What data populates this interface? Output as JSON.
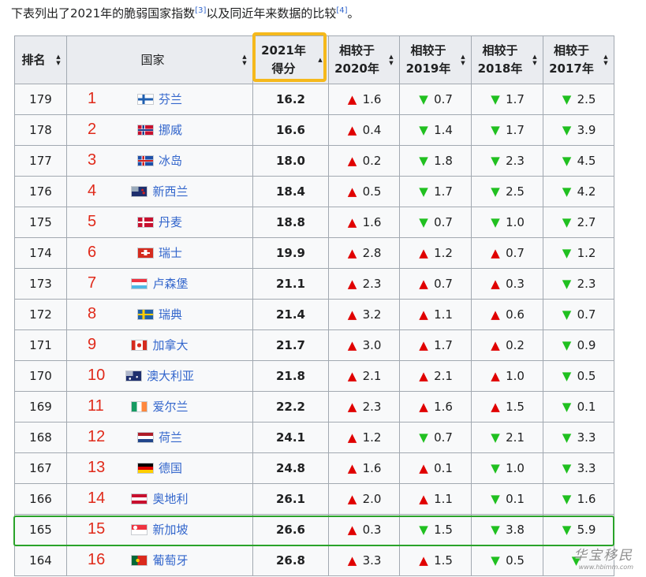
{
  "intro": {
    "text": "下表列出了2021年的脆弱国家指数",
    "ref1": "[3]",
    "mid": "以及同近年来数据的比较",
    "ref2": "[4]",
    "end": "。"
  },
  "headers": {
    "rank": "排名",
    "country": "国家",
    "score": [
      "2021年",
      "得分"
    ],
    "cmp2020": [
      "相较于",
      "2020年"
    ],
    "cmp2019": [
      "相较于",
      "2019年"
    ],
    "cmp2018": [
      "相较于",
      "2018年"
    ],
    "cmp2017": [
      "相较于",
      "2017年"
    ]
  },
  "colors": {
    "up": "#e00000",
    "down": "#20c020",
    "order_number": "#e02a1a",
    "highlight_column": "#f5b91c",
    "highlight_row": "#2aa32a"
  },
  "rows": [
    {
      "rank": "179",
      "order": "1",
      "country": "芬兰",
      "flag": "finland-flag",
      "score": "16.2",
      "c2020": {
        "dir": "up",
        "v": "1.6"
      },
      "c2019": {
        "dir": "down",
        "v": "0.7"
      },
      "c2018": {
        "dir": "down",
        "v": "1.7"
      },
      "c2017": {
        "dir": "down",
        "v": "2.5"
      }
    },
    {
      "rank": "178",
      "order": "2",
      "country": "挪威",
      "flag": "norway-flag",
      "score": "16.6",
      "c2020": {
        "dir": "up",
        "v": "0.4"
      },
      "c2019": {
        "dir": "down",
        "v": "1.4"
      },
      "c2018": {
        "dir": "down",
        "v": "1.7"
      },
      "c2017": {
        "dir": "down",
        "v": "3.9"
      }
    },
    {
      "rank": "177",
      "order": "3",
      "country": "冰岛",
      "flag": "iceland-flag",
      "score": "18.0",
      "c2020": {
        "dir": "up",
        "v": "0.2"
      },
      "c2019": {
        "dir": "down",
        "v": "1.8"
      },
      "c2018": {
        "dir": "down",
        "v": "2.3"
      },
      "c2017": {
        "dir": "down",
        "v": "4.5"
      }
    },
    {
      "rank": "176",
      "order": "4",
      "country": "新西兰",
      "flag": "new-zealand-flag",
      "score": "18.4",
      "c2020": {
        "dir": "up",
        "v": "0.5"
      },
      "c2019": {
        "dir": "down",
        "v": "1.7"
      },
      "c2018": {
        "dir": "down",
        "v": "2.5"
      },
      "c2017": {
        "dir": "down",
        "v": "4.2"
      }
    },
    {
      "rank": "175",
      "order": "5",
      "country": "丹麦",
      "flag": "denmark-flag",
      "score": "18.8",
      "c2020": {
        "dir": "up",
        "v": "1.6"
      },
      "c2019": {
        "dir": "down",
        "v": "0.7"
      },
      "c2018": {
        "dir": "down",
        "v": "1.0"
      },
      "c2017": {
        "dir": "down",
        "v": "2.7"
      }
    },
    {
      "rank": "174",
      "order": "6",
      "country": "瑞士",
      "flag": "switzerland-flag",
      "score": "19.9",
      "c2020": {
        "dir": "up",
        "v": "2.8"
      },
      "c2019": {
        "dir": "up",
        "v": "1.2"
      },
      "c2018": {
        "dir": "up",
        "v": "0.7"
      },
      "c2017": {
        "dir": "down",
        "v": "1.2"
      }
    },
    {
      "rank": "173",
      "order": "7",
      "country": "卢森堡",
      "flag": "luxembourg-flag",
      "score": "21.1",
      "c2020": {
        "dir": "up",
        "v": "2.3"
      },
      "c2019": {
        "dir": "up",
        "v": "0.7"
      },
      "c2018": {
        "dir": "up",
        "v": "0.3"
      },
      "c2017": {
        "dir": "down",
        "v": "2.3"
      }
    },
    {
      "rank": "172",
      "order": "8",
      "country": "瑞典",
      "flag": "sweden-flag",
      "score": "21.4",
      "c2020": {
        "dir": "up",
        "v": "3.2"
      },
      "c2019": {
        "dir": "up",
        "v": "1.1"
      },
      "c2018": {
        "dir": "up",
        "v": "0.6"
      },
      "c2017": {
        "dir": "down",
        "v": "0.7"
      }
    },
    {
      "rank": "171",
      "order": "9",
      "country": "加拿大",
      "flag": "canada-flag",
      "score": "21.7",
      "c2020": {
        "dir": "up",
        "v": "3.0"
      },
      "c2019": {
        "dir": "up",
        "v": "1.7"
      },
      "c2018": {
        "dir": "up",
        "v": "0.2"
      },
      "c2017": {
        "dir": "down",
        "v": "0.9"
      }
    },
    {
      "rank": "170",
      "order": "10",
      "country": "澳大利亚",
      "flag": "australia-flag",
      "score": "21.8",
      "c2020": {
        "dir": "up",
        "v": "2.1"
      },
      "c2019": {
        "dir": "up",
        "v": "2.1"
      },
      "c2018": {
        "dir": "up",
        "v": "1.0"
      },
      "c2017": {
        "dir": "down",
        "v": "0.5"
      }
    },
    {
      "rank": "169",
      "order": "11",
      "country": "爱尔兰",
      "flag": "ireland-flag",
      "score": "22.2",
      "c2020": {
        "dir": "up",
        "v": "2.3"
      },
      "c2019": {
        "dir": "up",
        "v": "1.6"
      },
      "c2018": {
        "dir": "up",
        "v": "1.5"
      },
      "c2017": {
        "dir": "down",
        "v": "0.1"
      }
    },
    {
      "rank": "168",
      "order": "12",
      "country": "荷兰",
      "flag": "netherlands-flag",
      "score": "24.1",
      "c2020": {
        "dir": "up",
        "v": "1.2"
      },
      "c2019": {
        "dir": "down",
        "v": "0.7"
      },
      "c2018": {
        "dir": "down",
        "v": "2.1"
      },
      "c2017": {
        "dir": "down",
        "v": "3.3"
      }
    },
    {
      "rank": "167",
      "order": "13",
      "country": "德国",
      "flag": "germany-flag",
      "score": "24.8",
      "c2020": {
        "dir": "up",
        "v": "1.6"
      },
      "c2019": {
        "dir": "up",
        "v": "0.1"
      },
      "c2018": {
        "dir": "down",
        "v": "1.0"
      },
      "c2017": {
        "dir": "down",
        "v": "3.3"
      }
    },
    {
      "rank": "166",
      "order": "14",
      "country": "奥地利",
      "flag": "austria-flag",
      "score": "26.1",
      "c2020": {
        "dir": "up",
        "v": "2.0"
      },
      "c2019": {
        "dir": "up",
        "v": "1.1"
      },
      "c2018": {
        "dir": "down",
        "v": "0.1"
      },
      "c2017": {
        "dir": "down",
        "v": "1.6"
      }
    },
    {
      "rank": "165",
      "order": "15",
      "country": "新加坡",
      "flag": "singapore-flag",
      "score": "26.6",
      "c2020": {
        "dir": "up",
        "v": "0.3"
      },
      "c2019": {
        "dir": "down",
        "v": "1.5"
      },
      "c2018": {
        "dir": "down",
        "v": "3.8"
      },
      "c2017": {
        "dir": "down",
        "v": "5.9"
      }
    },
    {
      "rank": "164",
      "order": "16",
      "country": "葡萄牙",
      "flag": "portugal-flag",
      "score": "26.8",
      "c2020": {
        "dir": "up",
        "v": "3.3"
      },
      "c2019": {
        "dir": "up",
        "v": "1.5"
      },
      "c2018": {
        "dir": "down",
        "v": "0.5"
      },
      "c2017": {
        "dir": "down",
        "v": ""
      }
    }
  ],
  "watermark": {
    "text": "华宝移民",
    "sub": "www.hbimm.com"
  }
}
